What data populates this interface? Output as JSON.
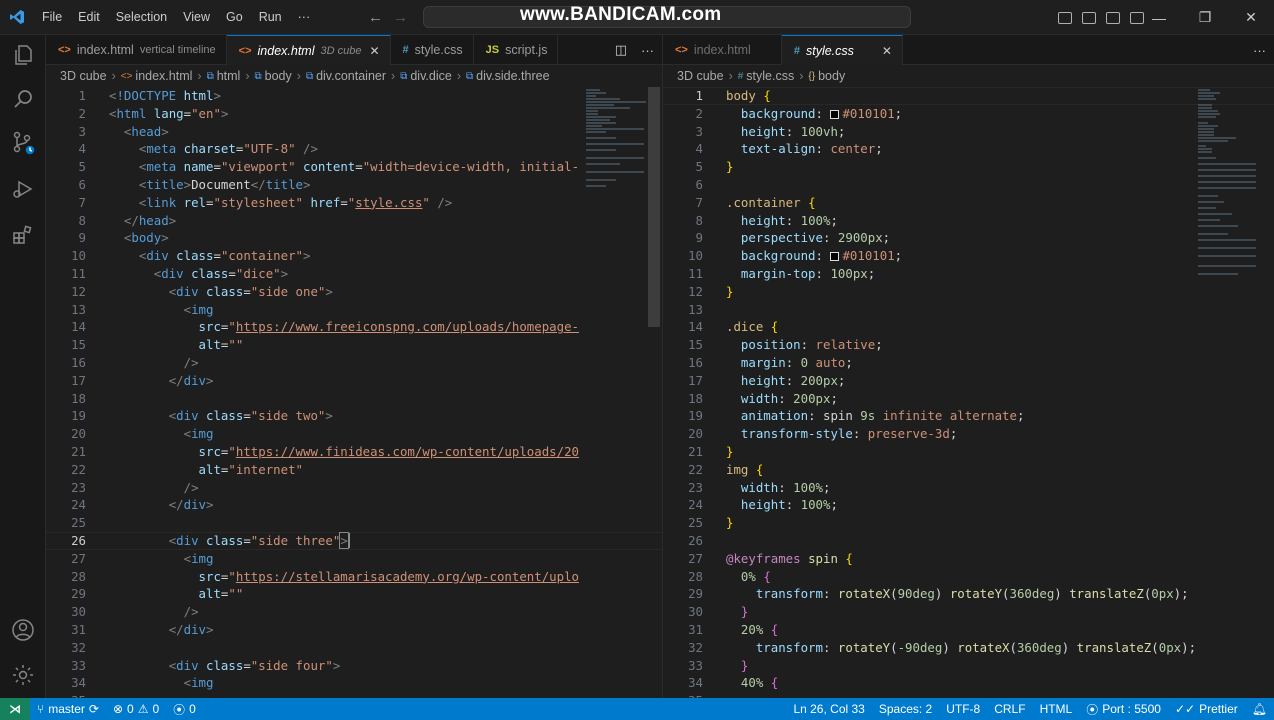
{
  "titlebar": {
    "menu": [
      "File",
      "Edit",
      "Selection",
      "View",
      "Go",
      "Run",
      "···"
    ],
    "watermark": "www.BANDICAM.com"
  },
  "colors": {
    "accent": "#007acc",
    "remote": "#16825d"
  },
  "left_editor": {
    "tabs": [
      {
        "icon": "<>",
        "label": "index.html",
        "desc": "vertical timeline",
        "active": false
      },
      {
        "icon": "<>",
        "label": "index.html",
        "desc": "3D cube",
        "active": true,
        "close": "✕"
      },
      {
        "icon": "#",
        "label": "style.css",
        "desc": "",
        "active": false
      },
      {
        "icon": "JS",
        "label": "script.js",
        "desc": "",
        "active": false
      }
    ],
    "breadcrumb": [
      "3D cube",
      "index.html",
      "html",
      "body",
      "div.container",
      "div.dice",
      "div.side.three"
    ],
    "line_numbers": [
      "1",
      "2",
      "3",
      "4",
      "5",
      "6",
      "7",
      "8",
      "9",
      "10",
      "11",
      "12",
      "13",
      "14",
      "15",
      "16",
      "17",
      "18",
      "19",
      "20",
      "21",
      "22",
      "23",
      "24",
      "25",
      "26",
      "27",
      "28",
      "29",
      "30",
      "31",
      "32",
      "33",
      "34",
      "35"
    ],
    "current_line": "26"
  },
  "right_editor": {
    "tabs": [
      {
        "icon": "<>",
        "label": "index.html",
        "active": false
      },
      {
        "icon": "#",
        "label": "style.css",
        "active": true,
        "close": "✕"
      }
    ],
    "breadcrumb": [
      "3D cube",
      "style.css",
      "body"
    ],
    "line_numbers": [
      "1",
      "2",
      "3",
      "4",
      "5",
      "6",
      "7",
      "8",
      "9",
      "10",
      "11",
      "12",
      "13",
      "14",
      "15",
      "16",
      "17",
      "18",
      "19",
      "20",
      "21",
      "22",
      "23",
      "24",
      "25",
      "26",
      "27",
      "28",
      "29",
      "30",
      "31",
      "32",
      "33",
      "34",
      "35"
    ]
  },
  "statusbar": {
    "branch": "master",
    "errors": "0",
    "warnings": "0",
    "ports": "0",
    "cursor": "Ln 26, Col 33",
    "spaces": "Spaces: 2",
    "encoding": "UTF-8",
    "eol": "CRLF",
    "language": "HTML",
    "port": "Port : 5500",
    "formatter": "Prettier"
  }
}
